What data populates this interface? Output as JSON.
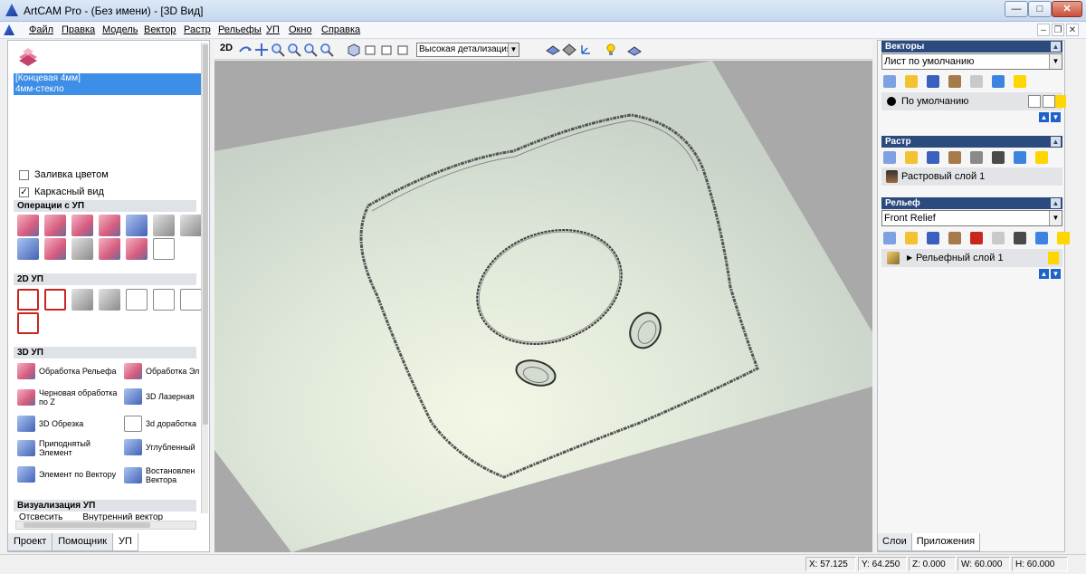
{
  "window": {
    "title": "ArtCAM Pro - (Без имени) - [3D Вид]",
    "minimize": "—",
    "maximize": "□",
    "close": "✕"
  },
  "menu": {
    "items": [
      "Файл",
      "Правка",
      "Модель",
      "Вектор",
      "Растр",
      "Рельефы",
      "УП",
      "Окно",
      "Справка"
    ],
    "mdi_min": "–",
    "mdi_restore": "❐",
    "mdi_close": "✕"
  },
  "left": {
    "tool_list": [
      "[Концевая 4мм]",
      "4мм-стекло"
    ],
    "fill_color": "Заливка цветом",
    "fill_checked": "",
    "wireframe": "Каркасный вид",
    "wireframe_checked": "✓",
    "sections": {
      "ops": "Операции с УП",
      "ops2d": "2D УП",
      "ops3d": "3D УП",
      "vis": "Визуализация УП"
    },
    "list3d": [
      "Обработка Рельефа",
      "Обработка Эл",
      "Черновая обработка по Z",
      "3D Лазерная",
      "3D Обрезка",
      "3d доработка",
      "Приподнятый Элемент",
      "Углубленный",
      "Элемент по Вектору",
      "Востановлен Вектора"
    ],
    "vis_partial": [
      "Отсвесить",
      "Внутренний вектор"
    ],
    "tabs": [
      "Проект",
      "Помощник",
      "УП"
    ],
    "active_tab": "УП"
  },
  "view": {
    "toggle_2d": "2D",
    "detail_select": "Высокая детализация"
  },
  "right": {
    "vectors": {
      "header": "Векторы",
      "combo": "Лист по умолчанию",
      "layer": "По умолчанию"
    },
    "raster": {
      "header": "Растр",
      "layer": "Растровый слой 1"
    },
    "relief": {
      "header": "Рельеф",
      "combo": "Front Relief",
      "layer": "Рельефный слой 1"
    },
    "tabs": [
      "Слои",
      "Приложения"
    ],
    "active_tab": "Приложения"
  },
  "status": {
    "x": "X: 57.125",
    "y": "Y: 64.250",
    "z": "Z: 0.000",
    "w": "W: 60.000",
    "h": "H: 60.000"
  },
  "colors": {
    "selection_blue": "#3d8ee6",
    "panel_header": "#2b4a7d",
    "relief_surface": "#dfe8d9",
    "viewport_bg": "#a9a9a9"
  }
}
